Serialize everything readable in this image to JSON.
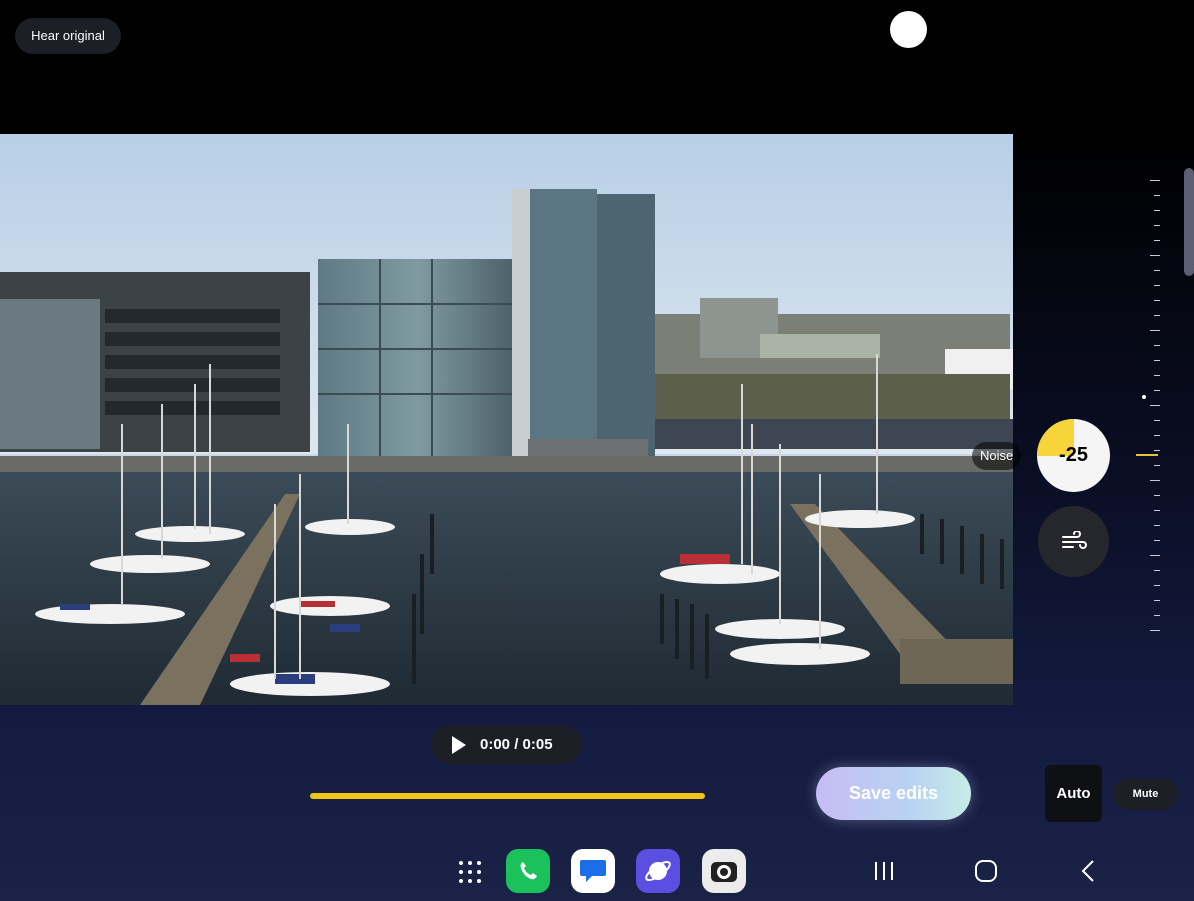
{
  "header": {
    "hear_original_label": "Hear original"
  },
  "noise": {
    "label": "Noise",
    "value": "-25",
    "level_fraction": 0.25
  },
  "player": {
    "time": "0:00 / 0:05",
    "progress_fraction": 0.0
  },
  "actions": {
    "save_label": "Save edits",
    "auto_label": "Auto",
    "mute_label": "Mute"
  },
  "colors": {
    "accent_yellow": "#f1c515",
    "phone_green": "#1bc15a",
    "browser_purple": "#5a4fe0"
  },
  "icons": [
    "wind-noise-icon",
    "apps-grid-icon",
    "phone-icon",
    "messages-icon",
    "browser-icon",
    "camera-icon",
    "recents-icon",
    "home-icon",
    "back-icon"
  ]
}
